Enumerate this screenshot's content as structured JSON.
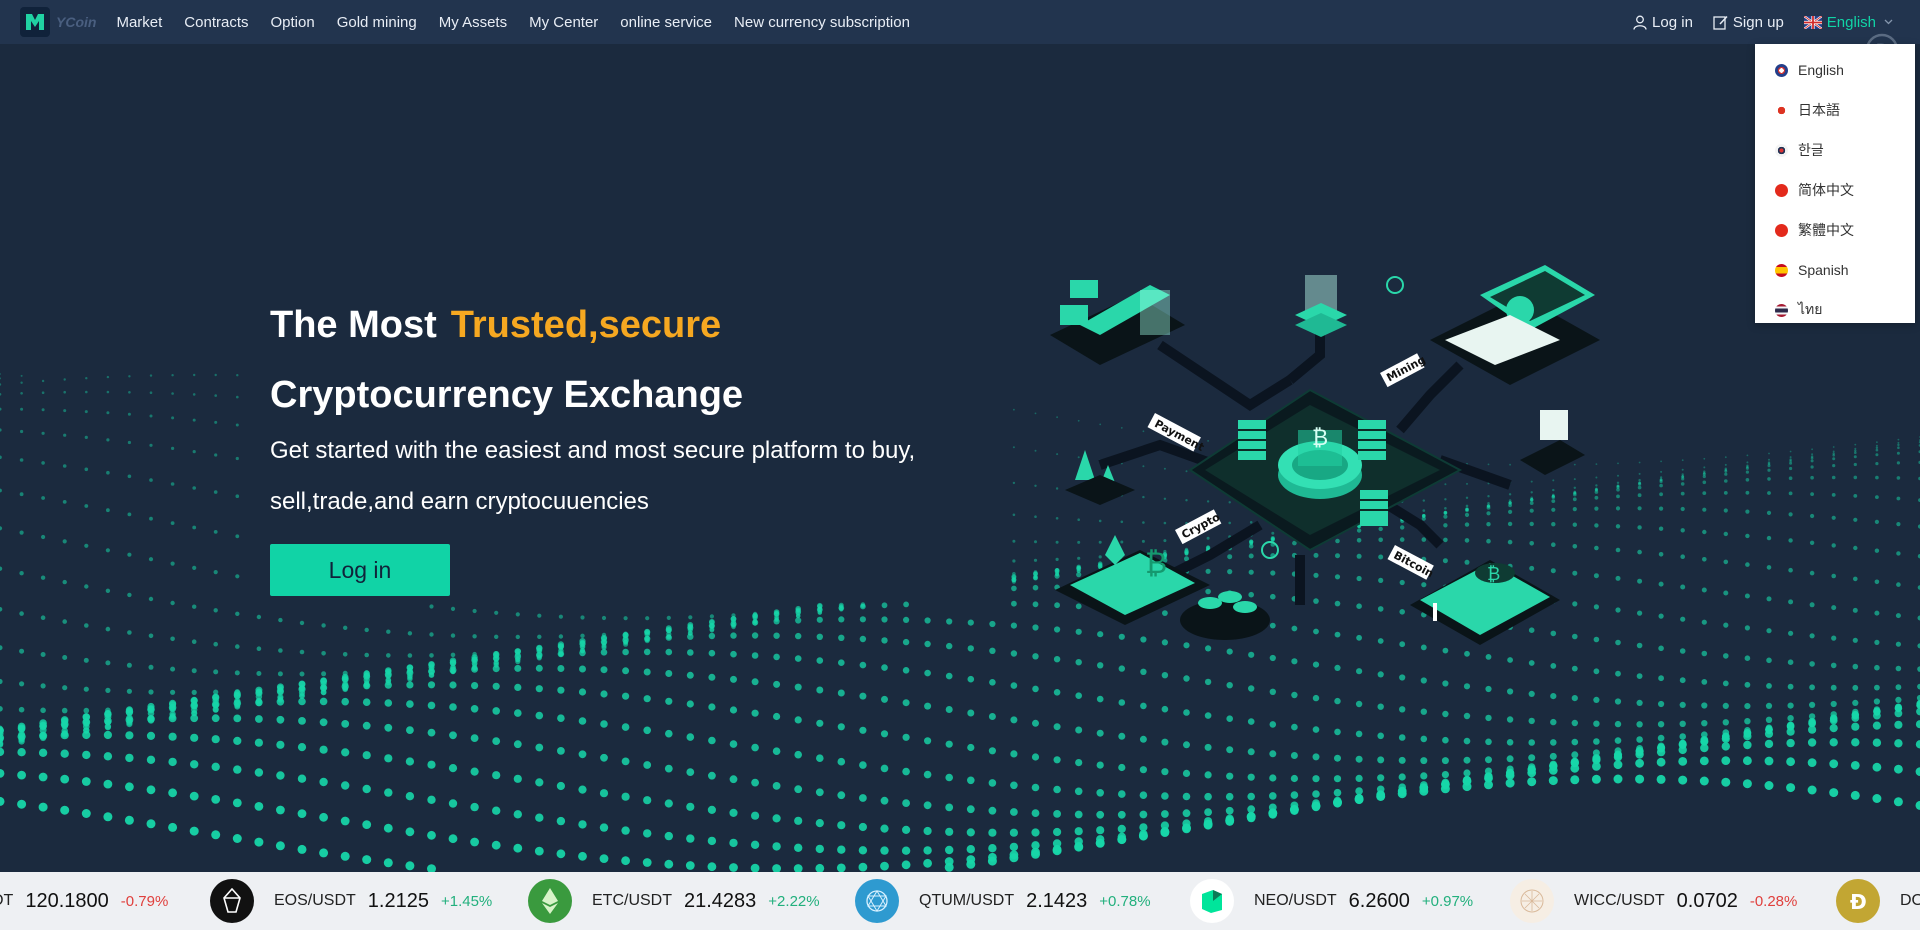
{
  "nav": {
    "logo_text": "YCoin",
    "items": [
      "Market",
      "Contracts",
      "Option",
      "Gold mining",
      "My Assets",
      "My Center",
      "online service",
      "New currency subscription"
    ],
    "login": "Log in",
    "signup": "Sign up",
    "language": "English"
  },
  "language_menu": [
    {
      "label": "English",
      "flag": "uk"
    },
    {
      "label": "日本語",
      "flag": "jp"
    },
    {
      "label": "한글",
      "flag": "kr"
    },
    {
      "label": "简体中文",
      "flag": "cn"
    },
    {
      "label": "繁體中文",
      "flag": "cn"
    },
    {
      "label": "Spanish",
      "flag": "es"
    },
    {
      "label": "ไทย",
      "flag": "th"
    }
  ],
  "hero": {
    "title_prefix": "The Most",
    "title_accent": "Trusted,secure",
    "title_line2": "Cryptocurrency Exchange",
    "subtitle_line1": "Get started with the easiest and most secure platform to buy,",
    "subtitle_line2": "sell,trade,and earn cryptocuuencies",
    "cta": "Log in",
    "illustration_labels": [
      "Payment",
      "Mining",
      "Crypto",
      "Bitcoin"
    ]
  },
  "ticker": [
    {
      "pair": "DT",
      "price": "120.1800",
      "change": "-0.79%",
      "dir": "down",
      "icon": "none"
    },
    {
      "pair": "EOS/USDT",
      "price": "1.2125",
      "change": "+1.45%",
      "dir": "up",
      "icon": "eos-icon"
    },
    {
      "pair": "ETC/USDT",
      "price": "21.4283",
      "change": "+2.22%",
      "dir": "up",
      "icon": "etc-icon"
    },
    {
      "pair": "QTUM/USDT",
      "price": "2.1423",
      "change": "+0.78%",
      "dir": "up",
      "icon": "qtum-icon"
    },
    {
      "pair": "NEO/USDT",
      "price": "6.2600",
      "change": "+0.97%",
      "dir": "up",
      "icon": "neo-icon"
    },
    {
      "pair": "WICC/USDT",
      "price": "0.0702",
      "change": "-0.28%",
      "dir": "down",
      "icon": "wicc-icon"
    },
    {
      "pair": "DO",
      "price": "",
      "change": "",
      "dir": "up",
      "icon": "doge-icon"
    }
  ],
  "colors": {
    "accent": "#11d3a6",
    "gold": "#f6a821",
    "bg": "#1b2a3e",
    "nav": "#22344e"
  }
}
